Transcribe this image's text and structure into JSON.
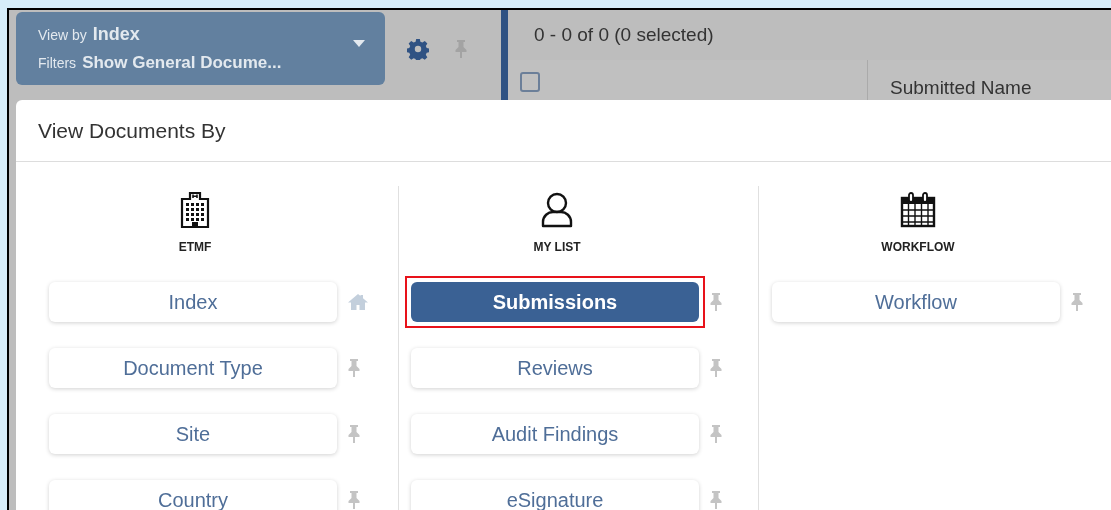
{
  "toolbar": {
    "view_by_label": "View by",
    "view_by_value": "Index",
    "filters_label": "Filters",
    "filters_value": "Show General Docume..."
  },
  "grid": {
    "count": "0 - 0 of 0 (0 selected)",
    "select_all_checked": false,
    "columns": [
      "Submitted Name"
    ]
  },
  "dialog": {
    "title": "View Documents By",
    "groups": [
      {
        "kind": "building",
        "label": "ETMF",
        "items": [
          {
            "label": "Index",
            "selected": false,
            "highlighted": false,
            "kind": "home"
          },
          {
            "label": "Document Type",
            "selected": false,
            "highlighted": false,
            "kind": "pin"
          },
          {
            "label": "Site",
            "selected": false,
            "highlighted": false,
            "kind": "pin"
          },
          {
            "label": "Country",
            "selected": false,
            "highlighted": false,
            "kind": "pin"
          }
        ]
      },
      {
        "kind": "person",
        "label": "MY LIST",
        "items": [
          {
            "label": "Submissions",
            "selected": true,
            "highlighted": true,
            "kind": "pin"
          },
          {
            "label": "Reviews",
            "selected": false,
            "highlighted": false,
            "kind": "pin"
          },
          {
            "label": "Audit Findings",
            "selected": false,
            "highlighted": false,
            "kind": "pin"
          },
          {
            "label": "eSignature",
            "selected": false,
            "highlighted": false,
            "kind": "pin"
          }
        ]
      },
      {
        "kind": "calendar",
        "label": "WORKFLOW",
        "items": [
          {
            "label": "Workflow",
            "selected": false,
            "highlighted": false,
            "kind": "pin"
          }
        ]
      }
    ]
  }
}
